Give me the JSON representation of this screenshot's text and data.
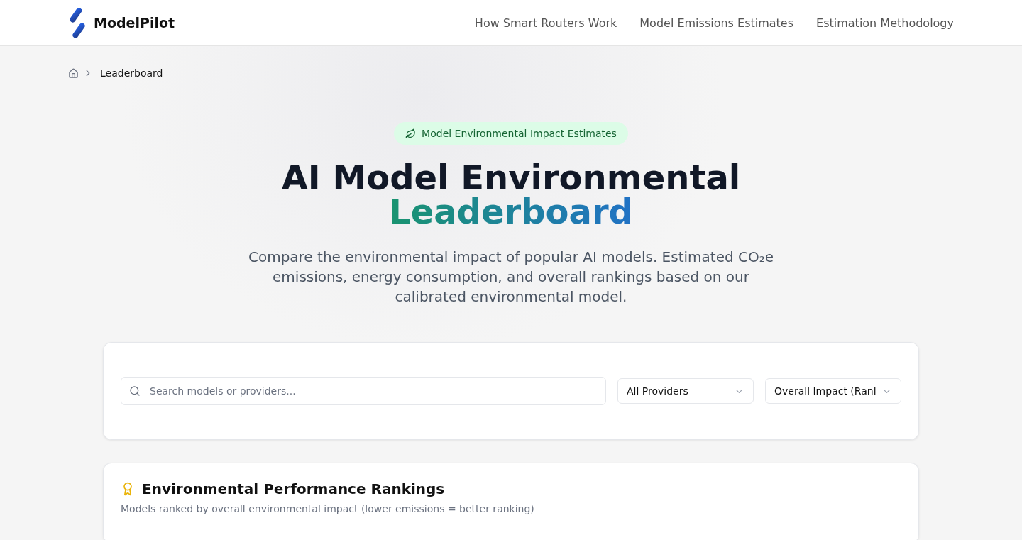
{
  "header": {
    "brand": "ModelPilot",
    "nav": [
      {
        "label": "How Smart Routers Work"
      },
      {
        "label": "Model Emissions Estimates"
      },
      {
        "label": "Estimation Methodology"
      }
    ]
  },
  "breadcrumb": {
    "current": "Leaderboard"
  },
  "hero": {
    "badge": "Model Environmental Impact Estimates",
    "title": "AI Model Environmental",
    "title_highlight": "Leaderboard",
    "subtitle": "Compare the environmental impact of popular AI models. Estimated CO₂e emissions, energy consumption, and overall rankings based on our calibrated environmental model."
  },
  "filters": {
    "search": {
      "placeholder": "Search models or providers..."
    },
    "selects": [
      {
        "value": "All Providers"
      },
      {
        "value": "Overall Impact (Ranl"
      }
    ]
  },
  "rankings": {
    "title": "Environmental Performance Rankings",
    "description": "Models ranked by overall environmental impact (lower emissions = better ranking)"
  }
}
